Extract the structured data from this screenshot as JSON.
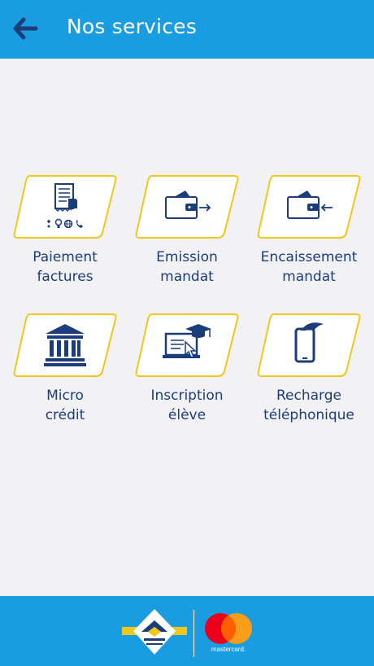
{
  "header": {
    "title": "Nos services",
    "back_icon": "arrow-left-icon"
  },
  "colors": {
    "header_bg": "#1a9ce0",
    "tile_border": "#f2c71b",
    "icon_navy": "#1b3d7a",
    "background": "#f2f2f4"
  },
  "services": [
    {
      "line1": "Paiement",
      "line2": "factures",
      "icon": "bill-payment-icon"
    },
    {
      "line1": "Emission",
      "line2": "mandat",
      "icon": "wallet-send-icon"
    },
    {
      "line1": "Encaissement",
      "line2": "mandat",
      "icon": "wallet-receive-icon"
    },
    {
      "line1": "Micro",
      "line2": "crédit",
      "icon": "bank-icon"
    },
    {
      "line1": "Inscription",
      "line2": "élève",
      "icon": "student-enrollment-icon"
    },
    {
      "line1": "Recharge",
      "line2": "téléphonique",
      "icon": "phone-recharge-icon"
    }
  ],
  "footer": {
    "brand_logo": "post-logo",
    "partner_logo": "mastercard-logo",
    "partner_text": "mastercard."
  }
}
